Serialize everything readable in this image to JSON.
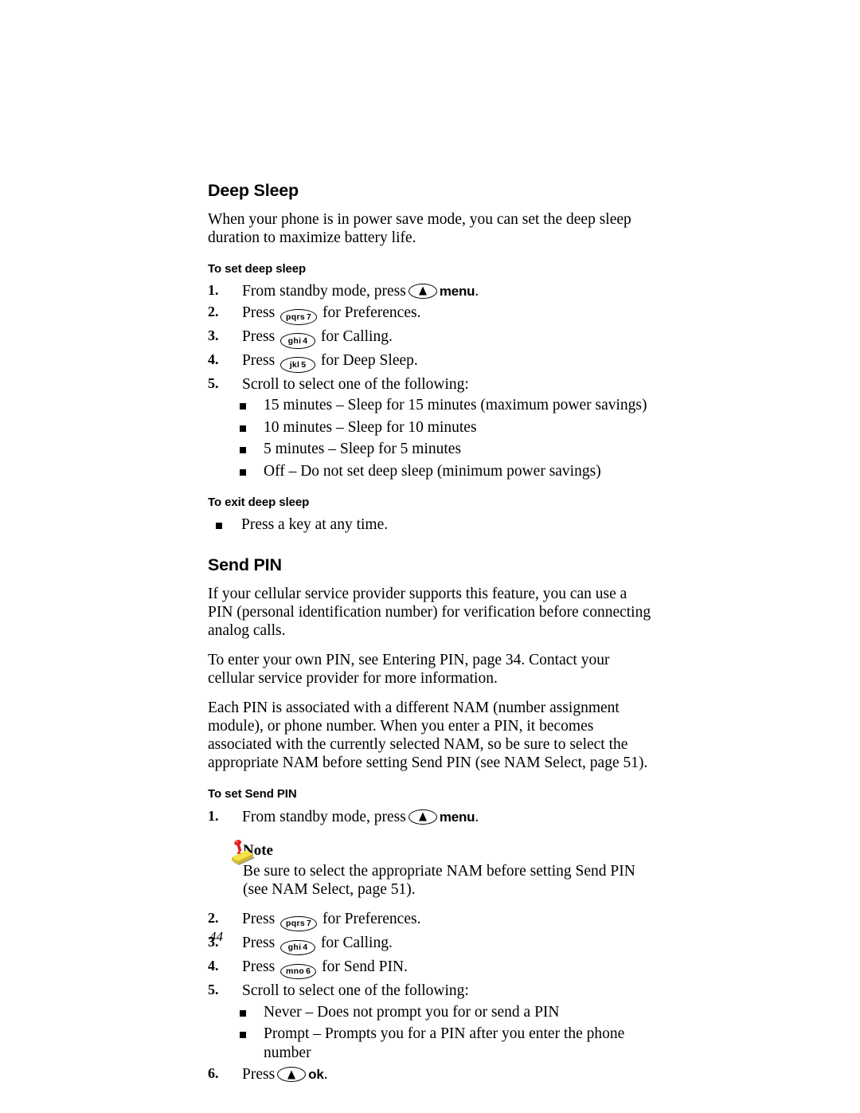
{
  "page": {
    "folio": "44"
  },
  "sections": {
    "deep_sleep": {
      "heading": "Deep Sleep",
      "intro": "When your phone is in power save mode, you can set the deep sleep duration to maximize battery life.",
      "set_subheading": "To set deep sleep",
      "steps": [
        {
          "num": "1.",
          "before": "From standby mode, press",
          "key": {
            "type": "nav",
            "label": "nav-up-key"
          },
          "soft_label": "menu",
          "after": "."
        },
        {
          "num": "2.",
          "before": "Press",
          "key": {
            "type": "digit",
            "letters": "pqrs",
            "digit": "7"
          },
          "after": "for Preferences."
        },
        {
          "num": "3.",
          "before": "Press",
          "key": {
            "type": "digit",
            "letters": "ghi",
            "digit": "4"
          },
          "after": "for Calling."
        },
        {
          "num": "4.",
          "before": "Press",
          "key": {
            "type": "digit",
            "letters": "jkl",
            "digit": "5"
          },
          "after": "for Deep Sleep."
        },
        {
          "num": "5.",
          "before": "Scroll to select one of the following:",
          "key": null,
          "after": ""
        }
      ],
      "options": [
        "15 minutes – Sleep for 15 minutes (maximum power savings)",
        "10 minutes – Sleep for 10 minutes",
        "5 minutes – Sleep for 5 minutes",
        "Off – Do not set deep sleep (minimum power savings)"
      ],
      "exit_subheading": "To exit deep sleep",
      "exit_bullet": "Press a key at any time."
    },
    "send_pin": {
      "heading": "Send PIN",
      "para1": "If your cellular service provider supports this feature, you can use a PIN (personal identification number) for verification before connecting analog calls.",
      "para2": "To enter your own PIN, see Entering PIN, page 34. Contact your cellular service provider for more information.",
      "para3": "Each PIN is associated with a different NAM (number assignment module), or phone number. When you enter a PIN, it becomes associated with the currently selected NAM, so be sure to select the appropriate NAM before setting Send PIN (see NAM Select, page 51).",
      "set_subheading": "To set Send PIN",
      "step1": {
        "num": "1.",
        "before": "From standby mode, press",
        "soft_label": "menu",
        "after": "."
      },
      "note": {
        "icon": "sticky-note-pushpin-icon",
        "title": "Note",
        "body": "Be sure to select the appropriate NAM before setting Send PIN (see NAM Select, page 51)."
      },
      "steps_rest": [
        {
          "num": "2.",
          "before": "Press",
          "key": {
            "type": "digit",
            "letters": "pqrs",
            "digit": "7"
          },
          "after": "for Preferences."
        },
        {
          "num": "3.",
          "before": "Press",
          "key": {
            "type": "digit",
            "letters": "ghi",
            "digit": "4"
          },
          "after": "for Calling."
        },
        {
          "num": "4.",
          "before": "Press",
          "key": {
            "type": "digit",
            "letters": "mno",
            "digit": "6"
          },
          "after": "for Send PIN."
        },
        {
          "num": "5.",
          "before": "Scroll to select one of the following:",
          "key": null,
          "after": ""
        }
      ],
      "options": [
        "Never – Does not prompt you for or send a PIN",
        "Prompt – Prompts you for a PIN after you enter the phone number"
      ],
      "final_step": {
        "num": "6.",
        "before": "Press",
        "soft_label": "ok",
        "after": "."
      }
    }
  },
  "colors": {
    "text": "#000000",
    "background": "#ffffff",
    "note_paper": "#f5e14a",
    "note_pin": "#e01b1b",
    "note_shadow": "#9a9a9a"
  }
}
